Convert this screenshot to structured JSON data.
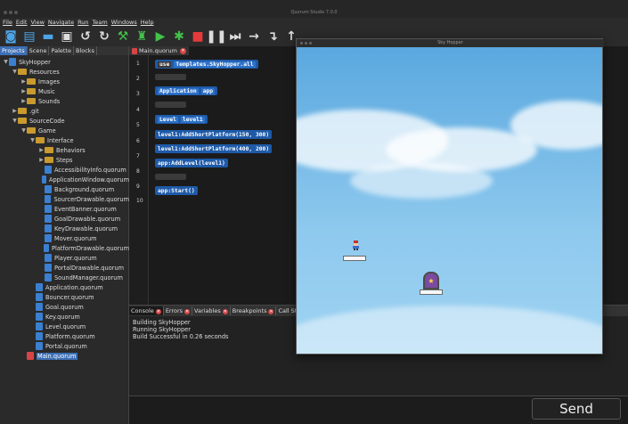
{
  "window": {
    "title": "Quorum Studio 7.0.0"
  },
  "menu": [
    "File",
    "Edit",
    "View",
    "Navigate",
    "Run",
    "Team",
    "Windows",
    "Help"
  ],
  "left_tabs": [
    "Projects",
    "Scene",
    "Palette",
    "Blocks"
  ],
  "tree": [
    {
      "label": "SkyHopper",
      "indent": 0,
      "type": "project",
      "arrow": "▼"
    },
    {
      "label": "Resources",
      "indent": 1,
      "type": "folder",
      "arrow": "▼"
    },
    {
      "label": "Images",
      "indent": 2,
      "type": "folder",
      "arrow": "▶"
    },
    {
      "label": "Music",
      "indent": 2,
      "type": "folder",
      "arrow": "▶"
    },
    {
      "label": "Sounds",
      "indent": 2,
      "type": "folder",
      "arrow": "▶"
    },
    {
      "label": ".git",
      "indent": 1,
      "type": "folder",
      "arrow": "▶"
    },
    {
      "label": "SourceCode",
      "indent": 1,
      "type": "folder",
      "arrow": "▼"
    },
    {
      "label": "Game",
      "indent": 2,
      "type": "folder",
      "arrow": "▼"
    },
    {
      "label": "Interface",
      "indent": 3,
      "type": "folder",
      "arrow": "▼"
    },
    {
      "label": "Behaviors",
      "indent": 4,
      "type": "folder",
      "arrow": "▶"
    },
    {
      "label": "Steps",
      "indent": 4,
      "type": "folder",
      "arrow": "▶"
    },
    {
      "label": "AccessibilityInfo.quorum",
      "indent": 4,
      "type": "file",
      "arrow": ""
    },
    {
      "label": "ApplicationWindow.quorum",
      "indent": 4,
      "type": "file",
      "arrow": ""
    },
    {
      "label": "Background.quorum",
      "indent": 4,
      "type": "file",
      "arrow": ""
    },
    {
      "label": "SourcerDrawable.quorum",
      "indent": 4,
      "type": "file",
      "arrow": ""
    },
    {
      "label": "EventBanner.quorum",
      "indent": 4,
      "type": "file",
      "arrow": ""
    },
    {
      "label": "GoalDrawable.quorum",
      "indent": 4,
      "type": "file",
      "arrow": ""
    },
    {
      "label": "KeyDrawable.quorum",
      "indent": 4,
      "type": "file",
      "arrow": ""
    },
    {
      "label": "Mover.quorum",
      "indent": 4,
      "type": "file",
      "arrow": ""
    },
    {
      "label": "PlatformDrawable.quorum",
      "indent": 4,
      "type": "file",
      "arrow": ""
    },
    {
      "label": "Player.quorum",
      "indent": 4,
      "type": "file",
      "arrow": ""
    },
    {
      "label": "PortalDrawable.quorum",
      "indent": 4,
      "type": "file",
      "arrow": ""
    },
    {
      "label": "SoundManager.quorum",
      "indent": 4,
      "type": "file",
      "arrow": ""
    },
    {
      "label": "Application.quorum",
      "indent": 3,
      "type": "file",
      "arrow": ""
    },
    {
      "label": "Bouncer.quorum",
      "indent": 3,
      "type": "file",
      "arrow": ""
    },
    {
      "label": "Goal.quorum",
      "indent": 3,
      "type": "file",
      "arrow": ""
    },
    {
      "label": "Key.quorum",
      "indent": 3,
      "type": "file",
      "arrow": ""
    },
    {
      "label": "Level.quorum",
      "indent": 3,
      "type": "file",
      "arrow": ""
    },
    {
      "label": "Platform.quorum",
      "indent": 3,
      "type": "file",
      "arrow": ""
    },
    {
      "label": "Portal.quorum",
      "indent": 3,
      "type": "file",
      "arrow": ""
    },
    {
      "label": "Main.quorum",
      "indent": 2,
      "type": "mainfile",
      "arrow": "",
      "selected": true
    }
  ],
  "editor": {
    "tab_label": "Main.quorum",
    "line_numbers": [
      "1",
      "2",
      "3",
      "4",
      "5",
      "6",
      "7",
      "8",
      "9",
      "10"
    ],
    "code": {
      "line1_kw": "use",
      "line1_arg": "Templates.SkyHopper.all",
      "line3_kw": "Application",
      "line3_arg": "app",
      "line5_kw": "Level",
      "line5_arg": "level1",
      "line6": "level1:AddShortPlatform(150, 300)",
      "line7": "level1:AddShortPlatform(400, 200)",
      "line8": "app:AddLevel(level1)",
      "line10": "app:Start()"
    }
  },
  "console": {
    "tabs": [
      "Console",
      "Errors",
      "Variables",
      "Breakpoints",
      "Call Sta"
    ],
    "lines": [
      "Building SkyHopper",
      "Running SkyHopper",
      "Build Successful in 0.26 seconds"
    ]
  },
  "send_label": "Send",
  "game_window": {
    "title": "Sky Hopper"
  },
  "colors": {
    "accent": "#3d6fb5",
    "block": "#1e5aa8",
    "folder": "#c99a2e",
    "error": "#d64545"
  }
}
